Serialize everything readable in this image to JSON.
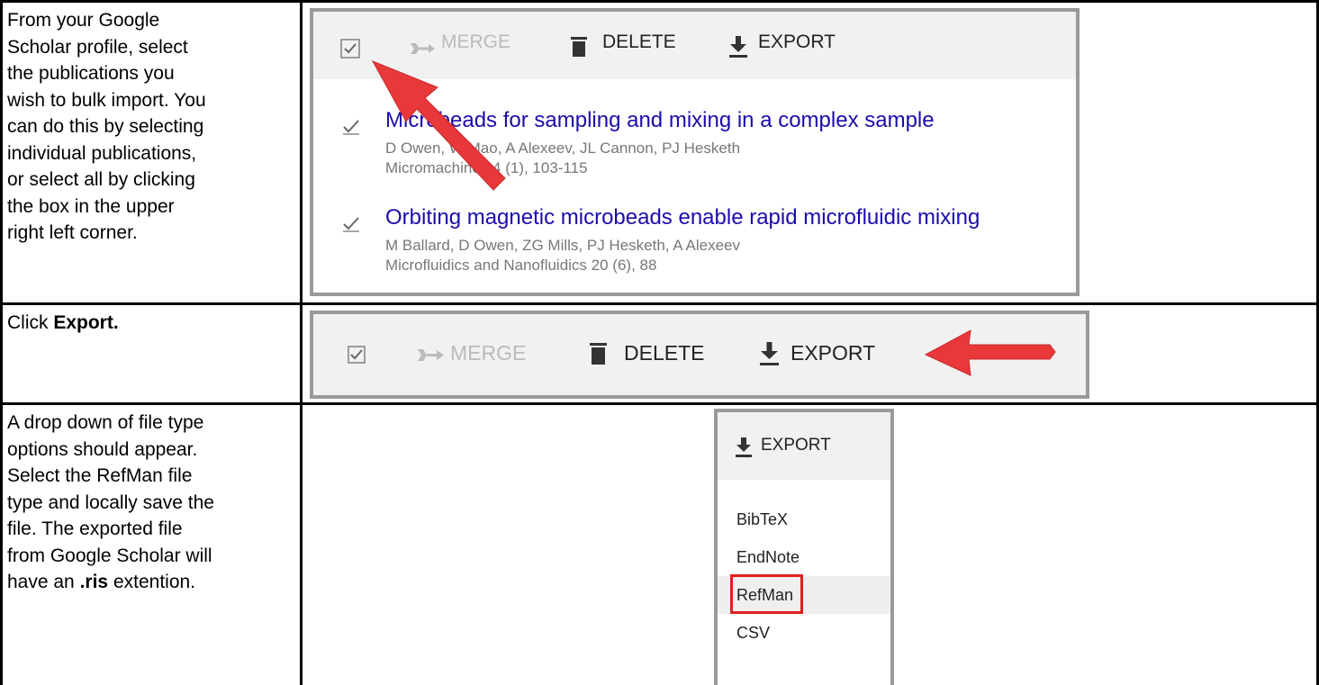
{
  "rows": [
    {
      "instruction_lines": [
        "From your Google",
        "Scholar profile, select",
        "the publications you",
        "wish to bulk import. You",
        "can do this by selecting",
        "individual publications,",
        "or select all by clicking",
        "the box in the upper",
        "right left corner."
      ]
    },
    {
      "instruction_prefix": "Click ",
      "instruction_bold": "Export."
    },
    {
      "instruction_lines": [
        "A drop down of file type",
        "options should appear.",
        "Select the RefMan file",
        "type and locally save the",
        "file. The exported file",
        "from Google Scholar will"
      ],
      "last_line_prefix": "have an ",
      "last_line_bold": ".ris",
      "last_line_suffix": " extention."
    }
  ],
  "toolbar": {
    "merge_label": "MERGE",
    "delete_label": "DELETE",
    "export_label": "EXPORT"
  },
  "publications": [
    {
      "title": "Microbeads for sampling and mixing in a complex sample",
      "authors": "D Owen, W Mao, A Alexeev, JL Cannon, PJ Hesketh",
      "venue": "Micromachines 4 (1), 103-115"
    },
    {
      "title": "Orbiting magnetic microbeads enable rapid microfluidic mixing",
      "authors": "M Ballard, D Owen, ZG Mills, PJ Hesketh, A Alexeev",
      "venue": "Microfluidics and Nanofluidics 20 (6), 88"
    }
  ],
  "export_menu": {
    "header_label": "EXPORT",
    "options": [
      "BibTeX",
      "EndNote",
      "RefMan",
      "CSV"
    ],
    "highlighted": "RefMan"
  },
  "colors": {
    "arrow": "#e8383a",
    "link": "#1a0dab",
    "highlight_box": "#e02020",
    "toolbar_bg": "#f1f1f1"
  }
}
